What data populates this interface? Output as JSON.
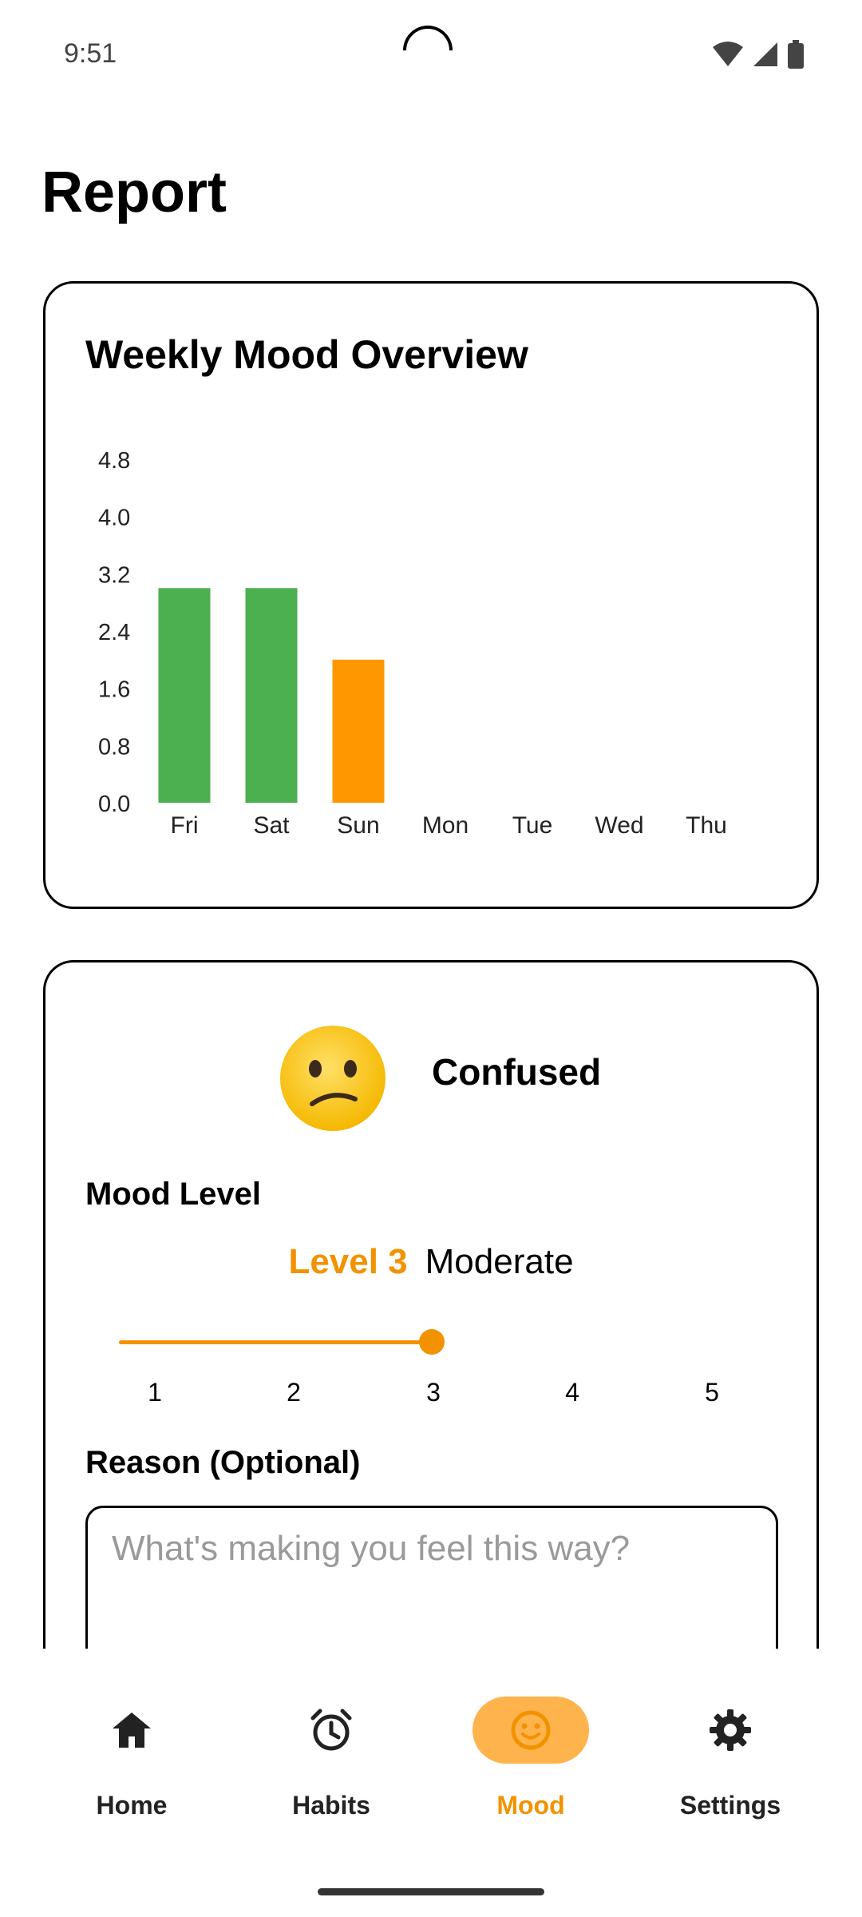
{
  "status": {
    "time": "9:51"
  },
  "page": {
    "title": "Report"
  },
  "chart_card": {
    "title": "Weekly Mood Overview"
  },
  "chart_data": {
    "type": "bar",
    "categories": [
      "Fri",
      "Sat",
      "Sun",
      "Mon",
      "Tue",
      "Wed",
      "Thu"
    ],
    "values": [
      3,
      3,
      2,
      null,
      null,
      null,
      null
    ],
    "bar_colors": [
      "#4caf50",
      "#4caf50",
      "#ff9800",
      null,
      null,
      null,
      null
    ],
    "yticks": [
      "0.0",
      "0.8",
      "1.6",
      "2.4",
      "3.2",
      "4.0",
      "4.8"
    ],
    "ylim": [
      0,
      4.8
    ],
    "title": "Weekly Mood Overview",
    "xlabel": "",
    "ylabel": "",
    "grid": false
  },
  "mood": {
    "name": "Confused",
    "emoji": "😕",
    "level_label": "Mood Level",
    "level_text": "Level 3",
    "level_desc": "Moderate",
    "level_value": 3,
    "ticks": [
      "1",
      "2",
      "3",
      "4",
      "5"
    ],
    "reason_label": "Reason (Optional)",
    "reason_placeholder": "What's making you feel this way?",
    "reason_value": ""
  },
  "nav": {
    "items": [
      {
        "label": "Home",
        "icon": "home-icon"
      },
      {
        "label": "Habits",
        "icon": "alarm-clock-icon"
      },
      {
        "label": "Mood",
        "icon": "smiley-icon"
      },
      {
        "label": "Settings",
        "icon": "gear-icon"
      }
    ],
    "active_index": 2
  },
  "colors": {
    "accent": "#f39200",
    "accent_light": "#ffb34d",
    "green": "#4caf50",
    "orange": "#ff9800"
  }
}
